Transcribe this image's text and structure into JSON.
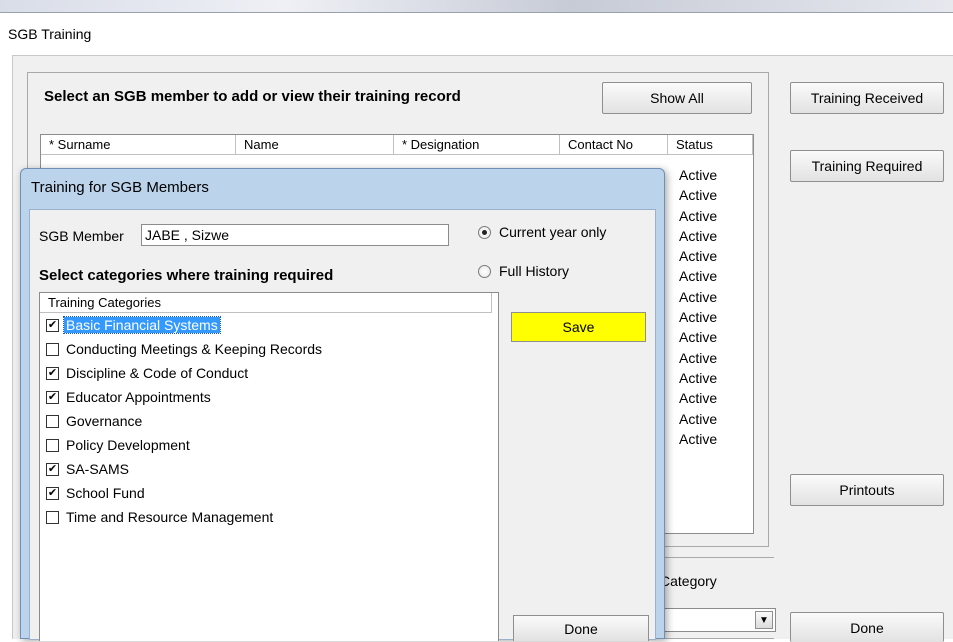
{
  "outer_window": {
    "title": "SGB Training",
    "heading": "Select an SGB member to add or view their training record",
    "show_all_label": "Show All",
    "training_received_label": "Training Received",
    "training_required_label": "Training Required",
    "printouts_label": "Printouts",
    "done_label": "Done",
    "category_label": "Category",
    "columns": [
      "* Surname",
      "Name",
      "* Designation",
      "Contact No",
      "Status"
    ],
    "statuses": [
      "Active",
      "Active",
      "Active",
      "Active",
      "Active",
      "Active",
      "Active",
      "Active",
      "Active",
      "Active",
      "Active",
      "Active",
      "Active",
      "Active"
    ]
  },
  "dialog": {
    "title": "Training for SGB Members",
    "member_label": "SGB Member",
    "member_value": "JABE , Sizwe",
    "radio_current": "Current year only",
    "radio_history": "Full History",
    "section_heading": "Select categories where training required",
    "list_header": "Training Categories",
    "save_label": "Save",
    "done_label": "Done",
    "categories": [
      {
        "label": "Basic Financial Systems",
        "checked": true,
        "selected": true
      },
      {
        "label": "Conducting Meetings & Keeping Records",
        "checked": false,
        "selected": false
      },
      {
        "label": "Discipline & Code of Conduct",
        "checked": true,
        "selected": false
      },
      {
        "label": "Educator Appointments",
        "checked": true,
        "selected": false
      },
      {
        "label": "Governance",
        "checked": false,
        "selected": false
      },
      {
        "label": "Policy Development",
        "checked": false,
        "selected": false
      },
      {
        "label": "SA-SAMS",
        "checked": true,
        "selected": false
      },
      {
        "label": "School Fund",
        "checked": true,
        "selected": false
      },
      {
        "label": "Time and Resource Management",
        "checked": false,
        "selected": false
      }
    ]
  },
  "colors": {
    "save_button": "#ffff00",
    "selection": "#3399ff",
    "dialog_frame": "#bcd3ec"
  }
}
